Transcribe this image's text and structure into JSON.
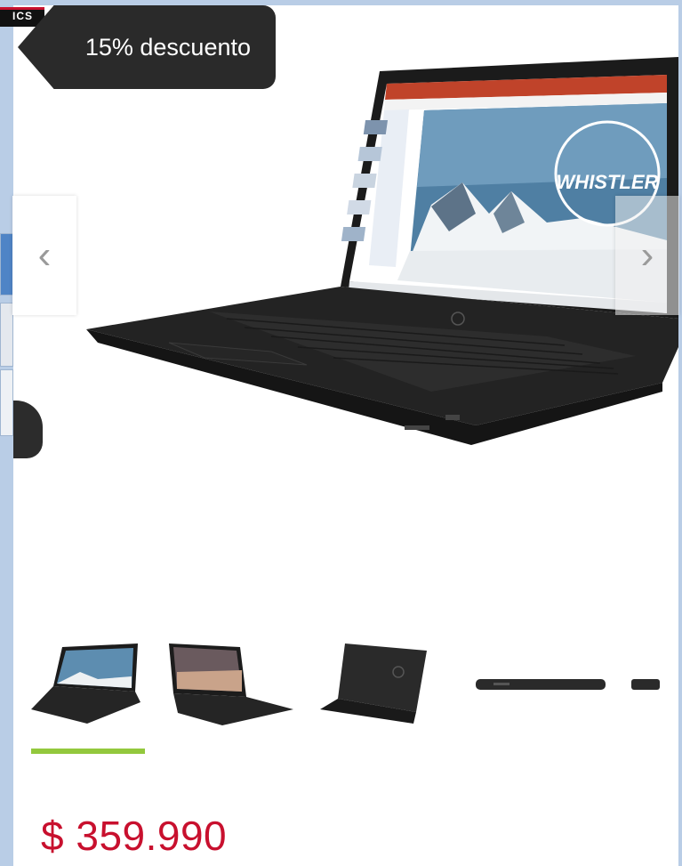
{
  "brand_corner": {
    "label": "ICS"
  },
  "discount": {
    "label": "15% descuento"
  },
  "gallery": {
    "main_image": "laptop-product-image",
    "screen_logo_text": "WHISTLER",
    "prev_icon": "chevron-left-icon",
    "next_icon": "chevron-right-icon",
    "prev_label": "‹",
    "next_label": "›",
    "thumbnails": [
      {
        "name": "front-open"
      },
      {
        "name": "front-open-sunset"
      },
      {
        "name": "back-closed"
      },
      {
        "name": "side-closed"
      },
      {
        "name": "side-closed-partial"
      }
    ],
    "active_index": 0,
    "active_color": "#93c83d"
  },
  "product": {
    "price": "$ 359.990"
  },
  "colors": {
    "price": "#c8102e",
    "tag_bg": "#2a2a2a",
    "frame": "#b9cde6"
  }
}
